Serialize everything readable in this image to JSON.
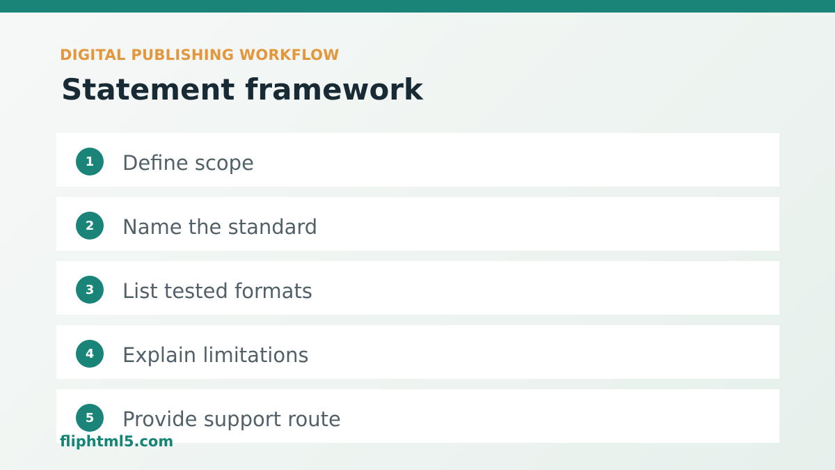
{
  "header": {
    "eyebrow": "DIGITAL PUBLISHING WORKFLOW",
    "title": "Statement framework"
  },
  "steps": [
    {
      "number": "1",
      "label": "Define scope"
    },
    {
      "number": "2",
      "label": "Name the standard"
    },
    {
      "number": "3",
      "label": "List tested formats"
    },
    {
      "number": "4",
      "label": "Explain limitations"
    },
    {
      "number": "5",
      "label": "Provide support route"
    }
  ],
  "footer": {
    "brand": "fliphtml5.com"
  },
  "colors": {
    "accent": "#1a8479",
    "eyebrow": "#e3973c",
    "title": "#182a33",
    "item_text": "#526068"
  }
}
